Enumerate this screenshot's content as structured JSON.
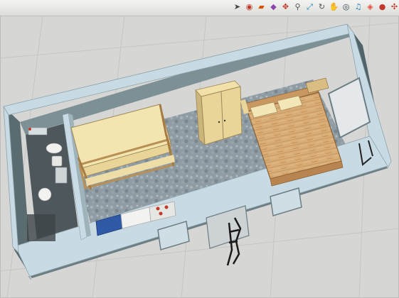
{
  "toolbar": {
    "tools": [
      {
        "name": "select-tool",
        "icon": "arrow-select-icon",
        "color": "#444444"
      },
      {
        "name": "paint-bucket-tool",
        "icon": "paint-bucket-icon",
        "color": "#c0392b"
      },
      {
        "name": "eraser-tool",
        "icon": "eraser-icon",
        "color": "#d35400"
      },
      {
        "name": "push-pull-tool",
        "icon": "push-pull-icon",
        "color": "#8e44ad"
      },
      {
        "name": "move-tool",
        "icon": "move-arrows-icon",
        "color": "#c0392b"
      },
      {
        "name": "zoom-tool",
        "icon": "magnifier-icon",
        "color": "#555555"
      },
      {
        "name": "zoom-extents-tool",
        "icon": "zoom-extents-icon",
        "color": "#2980b9"
      },
      {
        "name": "orbit-tool",
        "icon": "orbit-icon",
        "color": "#555555"
      },
      {
        "name": "pan-tool",
        "icon": "hand-pan-icon",
        "color": "#e67e22"
      },
      {
        "name": "look-around-tool",
        "icon": "eye-icon",
        "color": "#2c3e50"
      },
      {
        "name": "walk-tool",
        "icon": "footsteps-icon",
        "color": "#2980b9"
      },
      {
        "name": "section-plane-tool",
        "icon": "section-plane-icon",
        "color": "#e74c3c"
      },
      {
        "name": "get-models-tool",
        "icon": "globe-icon",
        "color": "#c0392b"
      },
      {
        "name": "share-model-tool",
        "icon": "share-icon",
        "color": "#c0392b"
      }
    ]
  },
  "viewport": {
    "background_color": "#d6d6d4",
    "grid_color": "#c4c4c2",
    "scene": "3d-model-container-home-floor-plan",
    "colors": {
      "outer_wall": "#6f8287",
      "wall_top": "#c9dbe6",
      "floor_carpet": "#8d9aa2",
      "bed_wood": "#d2a36d",
      "bed_frame": "#b88453",
      "bunk_mattress": "#f5e7b4",
      "wardrobe": "#ead79b",
      "kitchen_blue": "#2f5aa8",
      "window_glass": "#e3e7e8",
      "bathroom_floor": "#525c60"
    }
  }
}
